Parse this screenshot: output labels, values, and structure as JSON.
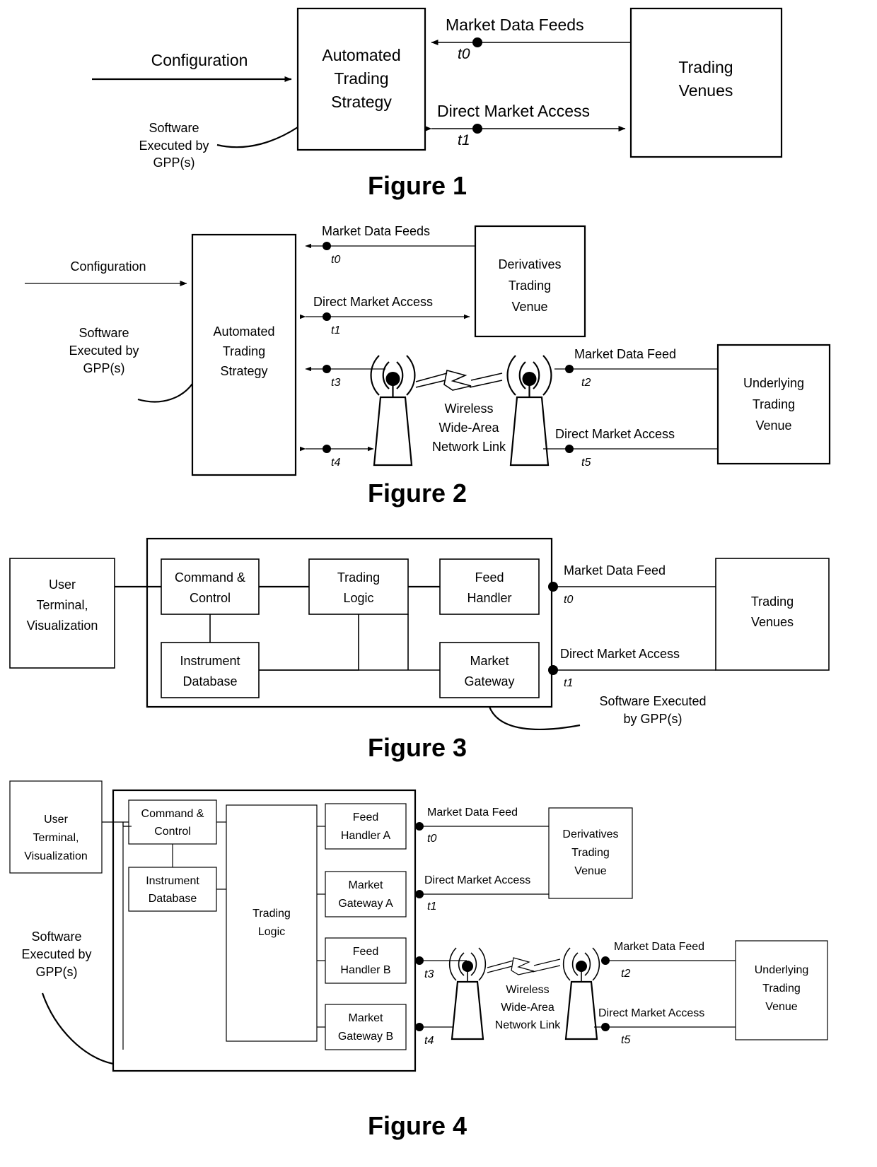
{
  "document": {
    "type": "patent-figure-sheet",
    "figure_count": 4
  },
  "figure1": {
    "caption": "Figure 1",
    "boxes": {
      "strategy": [
        "Automated",
        "Trading",
        "Strategy"
      ],
      "venues": [
        "Trading",
        "Venues"
      ]
    },
    "labels": {
      "configuration": "Configuration",
      "software_note": [
        "Software",
        "Executed by",
        "GPP(s)"
      ],
      "market_data_feeds": "Market Data Feeds",
      "direct_market_access": "Direct Market Access"
    },
    "timestamps": {
      "t0": "t0",
      "t1": "t1"
    }
  },
  "figure2": {
    "caption": "Figure 2",
    "boxes": {
      "strategy": [
        "Automated",
        "Trading",
        "Strategy"
      ],
      "derivatives_venue": [
        "Derivatives",
        "Trading",
        "Venue"
      ],
      "underlying_venue": [
        "Underlying",
        "Trading",
        "Venue"
      ]
    },
    "labels": {
      "configuration": "Configuration",
      "software_note": [
        "Software",
        "Executed by",
        "GPP(s)"
      ],
      "market_data_feeds": "Market Data Feeds",
      "direct_market_access": "Direct Market Access",
      "market_data_feed": "Market Data Feed",
      "direct_market_access_2": "Direct Market Access",
      "wireless_link": [
        "Wireless",
        "Wide-Area",
        "Network Link"
      ]
    },
    "timestamps": {
      "t0": "t0",
      "t1": "t1",
      "t2": "t2",
      "t3": "t3",
      "t4": "t4",
      "t5": "t5"
    }
  },
  "figure3": {
    "caption": "Figure 3",
    "boxes": {
      "user_terminal": [
        "User",
        "Terminal,",
        "Visualization"
      ],
      "command_control": [
        "Command &",
        "Control"
      ],
      "instrument_database": [
        "Instrument",
        "Database"
      ],
      "trading_logic": [
        "Trading",
        "Logic"
      ],
      "feed_handler": [
        "Feed",
        "Handler"
      ],
      "market_gateway": [
        "Market",
        "Gateway"
      ],
      "trading_venues": [
        "Trading",
        "Venues"
      ]
    },
    "labels": {
      "market_data_feed": "Market Data Feed",
      "direct_market_access": "Direct Market Access",
      "software_note": [
        "Software Executed",
        "by GPP(s)"
      ]
    },
    "timestamps": {
      "t0": "t0",
      "t1": "t1"
    }
  },
  "figure4": {
    "caption": "Figure 4",
    "boxes": {
      "user_terminal": [
        "User",
        "Terminal,",
        "Visualization"
      ],
      "command_control": [
        "Command &",
        "Control"
      ],
      "instrument_database": [
        "Instrument",
        "Database"
      ],
      "trading_logic": [
        "Trading",
        "Logic"
      ],
      "feed_handler_a": [
        "Feed",
        "Handler A"
      ],
      "market_gateway_a": [
        "Market",
        "Gateway A"
      ],
      "feed_handler_b": [
        "Feed",
        "Handler B"
      ],
      "market_gateway_b": [
        "Market",
        "Gateway B"
      ],
      "derivatives_venue": [
        "Derivatives",
        "Trading",
        "Venue"
      ],
      "underlying_venue": [
        "Underlying",
        "Trading",
        "Venue"
      ]
    },
    "labels": {
      "software_note": [
        "Software",
        "Executed by",
        "GPP(s)"
      ],
      "market_data_feed": "Market Data Feed",
      "direct_market_access": "Direct Market Access",
      "market_data_feed_2": "Market Data Feed",
      "direct_market_access_2": "Direct Market Access",
      "wireless_link": [
        "Wireless",
        "Wide-Area",
        "Network Link"
      ]
    },
    "timestamps": {
      "t0": "t0",
      "t1": "t1",
      "t2": "t2",
      "t3": "t3",
      "t4": "t4",
      "t5": "t5"
    }
  }
}
